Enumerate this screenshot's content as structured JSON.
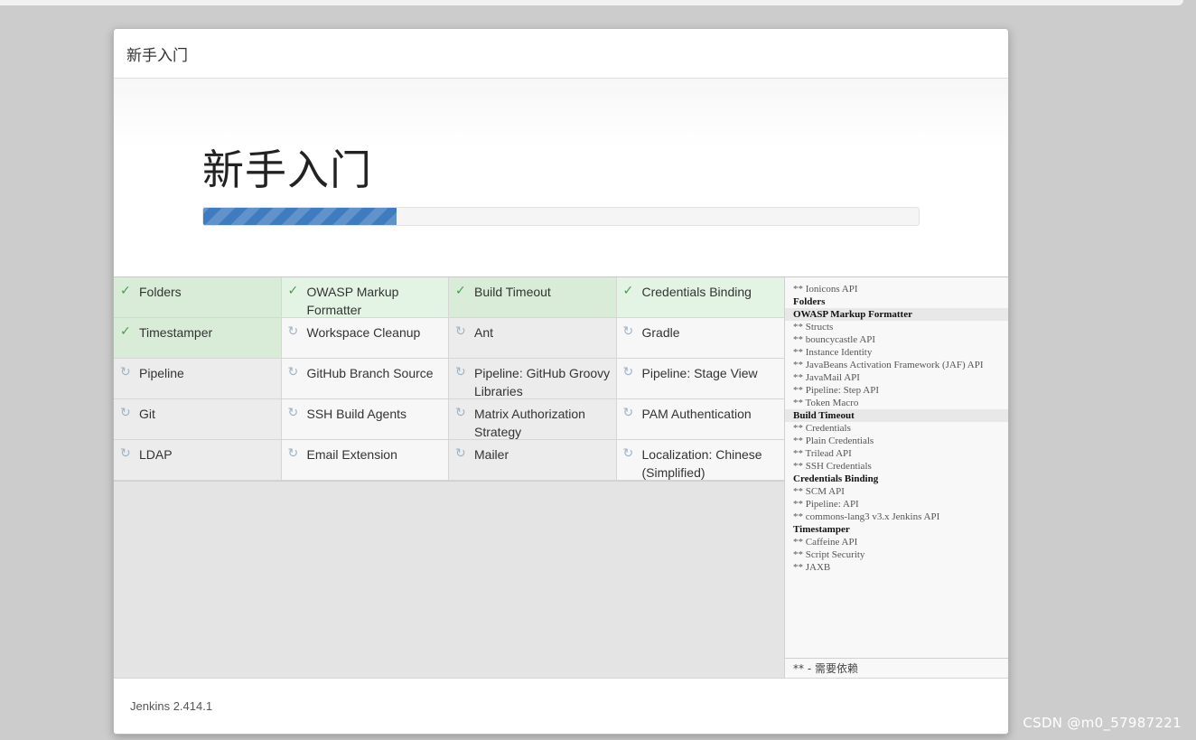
{
  "dialog": {
    "header_title": "新手入门",
    "hero_title": "新手入门",
    "progress_fraction": 0.27,
    "footer_version": "Jenkins 2.414.1"
  },
  "plugins": [
    {
      "name": "Folders",
      "status": "done",
      "icon": "check-icon"
    },
    {
      "name": "OWASP Markup Formatter",
      "status": "done",
      "icon": "check-icon"
    },
    {
      "name": "Build Timeout",
      "status": "done",
      "icon": "check-icon"
    },
    {
      "name": "Credentials Binding",
      "status": "done",
      "icon": "check-icon"
    },
    {
      "name": "Timestamper",
      "status": "done",
      "icon": "check-icon"
    },
    {
      "name": "Workspace Cleanup",
      "status": "pending",
      "icon": "refresh-icon"
    },
    {
      "name": "Ant",
      "status": "pending",
      "icon": "refresh-icon"
    },
    {
      "name": "Gradle",
      "status": "pending",
      "icon": "refresh-icon"
    },
    {
      "name": "Pipeline",
      "status": "pending",
      "icon": "refresh-icon"
    },
    {
      "name": "GitHub Branch Source",
      "status": "pending",
      "icon": "refresh-icon"
    },
    {
      "name": "Pipeline: GitHub Groovy Libraries",
      "status": "pending",
      "icon": "refresh-icon"
    },
    {
      "name": "Pipeline: Stage View",
      "status": "pending",
      "icon": "refresh-icon"
    },
    {
      "name": "Git",
      "status": "pending",
      "icon": "refresh-icon"
    },
    {
      "name": "SSH Build Agents",
      "status": "pending",
      "icon": "refresh-icon"
    },
    {
      "name": "Matrix Authorization Strategy",
      "status": "pending",
      "icon": "refresh-icon"
    },
    {
      "name": "PAM Authentication",
      "status": "pending",
      "icon": "refresh-icon"
    },
    {
      "name": "LDAP",
      "status": "pending",
      "icon": "refresh-icon"
    },
    {
      "name": "Email Extension",
      "status": "pending",
      "icon": "refresh-icon"
    },
    {
      "name": "Mailer",
      "status": "pending",
      "icon": "refresh-icon"
    },
    {
      "name": "Localization: Chinese (Simplified)",
      "status": "pending",
      "icon": "refresh-icon"
    }
  ],
  "log": [
    {
      "text": "** Ionicons API",
      "kind": "dep"
    },
    {
      "text": "Folders",
      "kind": "plugin"
    },
    {
      "text": "OWASP Markup Formatter",
      "kind": "plugin",
      "highlight": true
    },
    {
      "text": "** Structs",
      "kind": "dep"
    },
    {
      "text": "** bouncycastle API",
      "kind": "dep"
    },
    {
      "text": "** Instance Identity",
      "kind": "dep"
    },
    {
      "text": "** JavaBeans Activation Framework (JAF) API",
      "kind": "dep"
    },
    {
      "text": "** JavaMail API",
      "kind": "dep"
    },
    {
      "text": "** Pipeline: Step API",
      "kind": "dep"
    },
    {
      "text": "** Token Macro",
      "kind": "dep"
    },
    {
      "text": "Build Timeout",
      "kind": "plugin",
      "highlight": true
    },
    {
      "text": "** Credentials",
      "kind": "dep"
    },
    {
      "text": "** Plain Credentials",
      "kind": "dep"
    },
    {
      "text": "** Trilead API",
      "kind": "dep"
    },
    {
      "text": "** SSH Credentials",
      "kind": "dep"
    },
    {
      "text": "Credentials Binding",
      "kind": "plugin"
    },
    {
      "text": "** SCM API",
      "kind": "dep"
    },
    {
      "text": "** Pipeline: API",
      "kind": "dep"
    },
    {
      "text": "** commons-lang3 v3.x Jenkins API",
      "kind": "dep"
    },
    {
      "text": "Timestamper",
      "kind": "plugin"
    },
    {
      "text": "** Caffeine API",
      "kind": "dep"
    },
    {
      "text": "** Script Security",
      "kind": "dep"
    },
    {
      "text": "** JAXB",
      "kind": "dep"
    }
  ],
  "log_footer": "** - 需要依赖",
  "watermark": "CSDN @m0_57987221"
}
